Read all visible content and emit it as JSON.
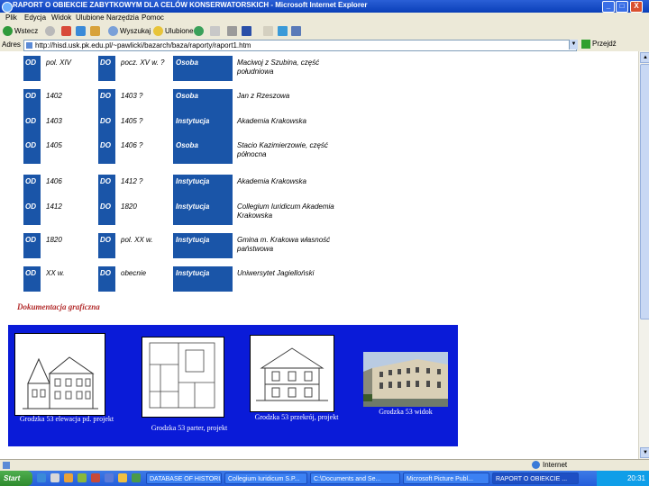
{
  "window": {
    "title": "RAPORT O OBIEKCIE ZABYTKOWYM DLA CELÓW KONSERWATORSKICH - Microsoft Internet Explorer",
    "btn_min": "_",
    "btn_max": "□",
    "btn_close": "X"
  },
  "menu": [
    "Plik",
    "Edycja",
    "Widok",
    "Ulubione",
    "Narzędzia",
    "Pomoc"
  ],
  "toolbar": {
    "back": "Wstecz",
    "search": "Wyszukaj",
    "favorites": "Ulubione"
  },
  "address": {
    "label": "Adres",
    "url": "http://hisd.usk.pk.edu.pl/~pawlicki/bazarch/baza/raporty/raport1.htm",
    "go": "Przejdź"
  },
  "history_rows": [
    {
      "od_label": "OD",
      "from": "pol. XIV",
      "do_label": "DO",
      "to": "pocz. XV w. ?",
      "category": "Osoba",
      "description": "Maciwoj z Szubina, część południowa"
    },
    {
      "od_label": "OD",
      "from": "1402",
      "do_label": "DO",
      "to": "1403 ?",
      "category": "Osoba",
      "description": "Jan z Rzeszowa"
    },
    {
      "od_label": "OD",
      "from": "1403",
      "do_label": "DO",
      "to": "1405 ?",
      "category": "Instytucja",
      "description": "Akademia Krakowska"
    },
    {
      "od_label": "OD",
      "from": "1405",
      "do_label": "DO",
      "to": "1406 ?",
      "category": "Osoba",
      "description": "Stacio Kazimierzowie, część północna"
    },
    {
      "od_label": "OD",
      "from": "1406",
      "do_label": "DO",
      "to": "1412 ?",
      "category": "Instytucja",
      "description": "Akademia Krakowska"
    },
    {
      "od_label": "OD",
      "from": "1412",
      "do_label": "DO",
      "to": "1820",
      "category": "Instytucja",
      "description": "Collegium Iuridicum Akademia Krakowska"
    },
    {
      "od_label": "OD",
      "from": "1820",
      "do_label": "DO",
      "to": "pol. XX w.",
      "category": "Instytucja",
      "description": "Gmina m. Krakowa własność państwowa"
    },
    {
      "od_label": "OD",
      "from": "XX w.",
      "do_label": "DO",
      "to": "obecnie",
      "category": "Instytucja",
      "description": "Uniwersytet Jagielloński"
    }
  ],
  "documentation": {
    "heading": "Dokumentacja graficzna",
    "items": [
      {
        "caption": "Grodzka 53 elewacja pd. projekt",
        "icon": "elevation-drawing"
      },
      {
        "caption": "Grodzka 53 parter, projekt",
        "icon": "floor-plan-drawing"
      },
      {
        "caption": "Grodzka 53 przekrój, projekt",
        "icon": "section-drawing"
      },
      {
        "caption": "Grodzka 53 widok",
        "icon": "building-photo"
      }
    ]
  },
  "status": {
    "zone": "Internet"
  },
  "taskbar": {
    "start": "Start",
    "tasks": [
      "DATABASE OF HISTORI...",
      "Collegium Iuridicum S.P...",
      "C:\\Documents and Se...",
      "Microsoft Picture Publ...",
      "RAPORT O OBIEKCIE ..."
    ],
    "time": "20:31"
  }
}
